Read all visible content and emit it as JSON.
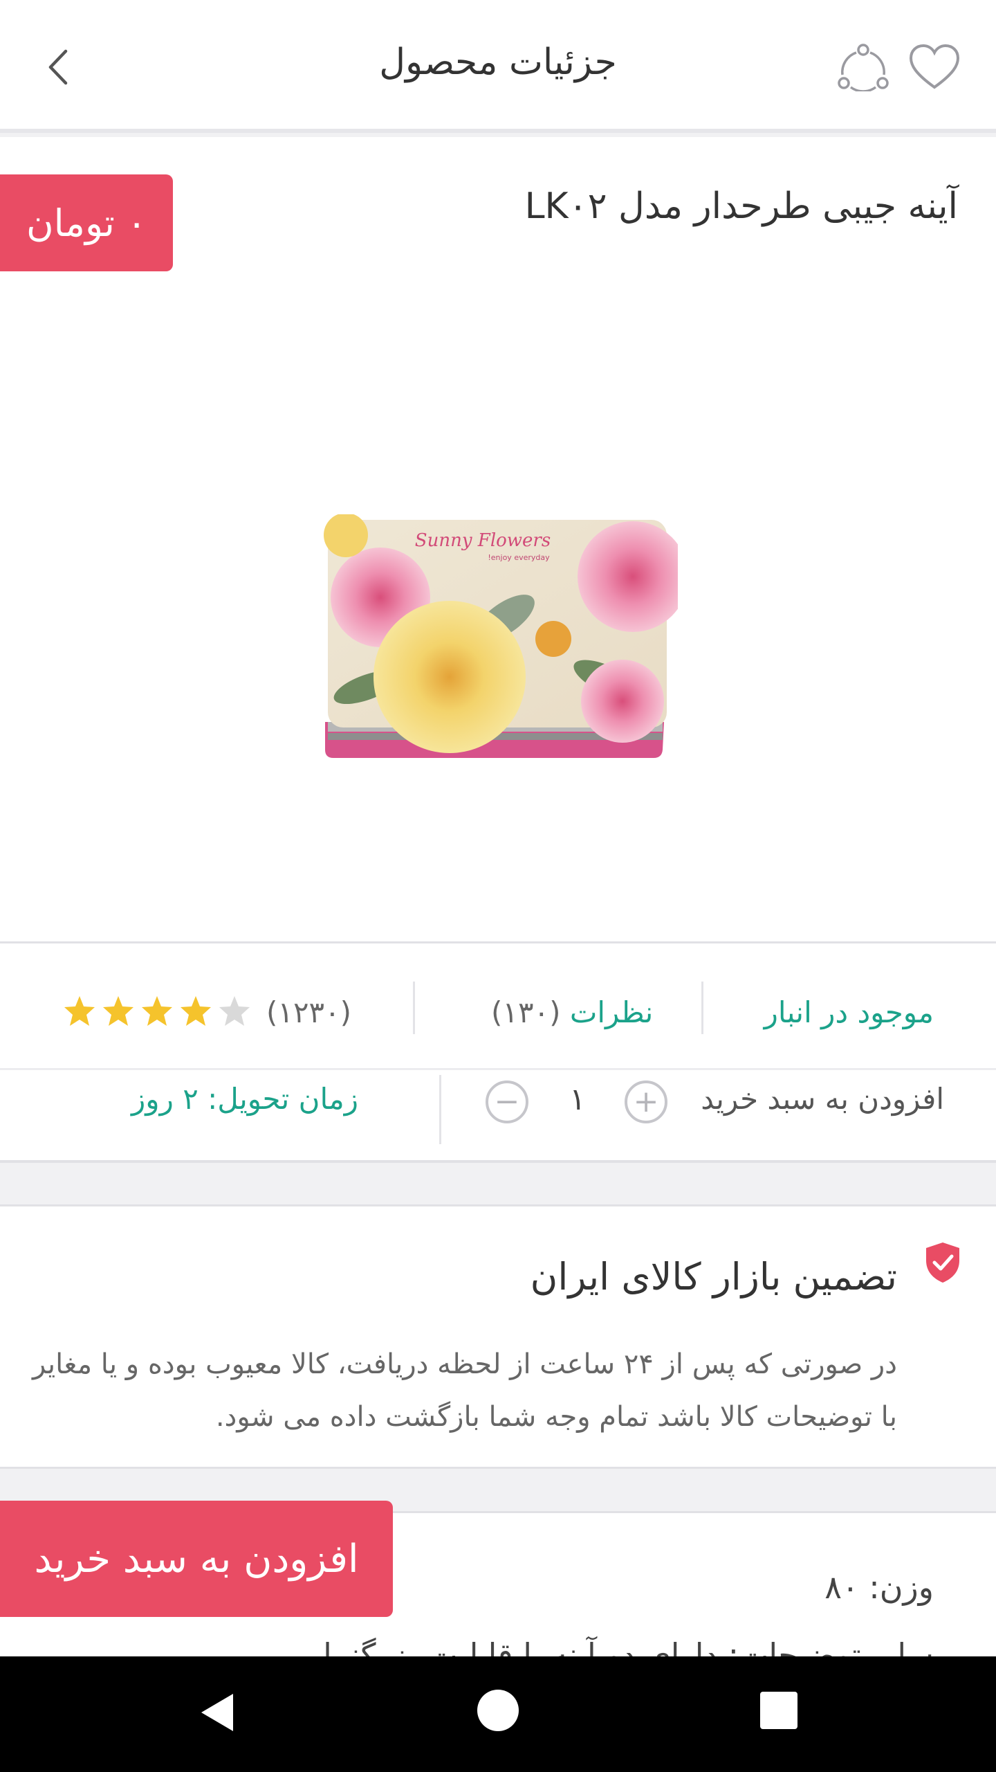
{
  "header": {
    "title": "جزئیات محصول"
  },
  "product": {
    "title": "آینه جیبی طرحدار مدل LK۰۲",
    "price": "۰ تومان",
    "image_text": {
      "brand": "Sunny Flowers",
      "tagline": "enjoy everyday!"
    }
  },
  "info": {
    "stock": "موجود در انبار",
    "reviews_label": "نظرات",
    "reviews_count": "(۱۳۰)",
    "rating_count": "(۱۲۳۰)",
    "rating": 4,
    "rating_max": 5,
    "add_to_cart_label": "افزودن به سبد خرید",
    "quantity": "۱",
    "delivery": "زمان تحویل: ۲ روز"
  },
  "guarantee": {
    "title": "تضمین بازار کالای ایران",
    "description": "در صورتی که پس از ۲۴ ساعت از لحظه دریافت، کالا معیوب بوده و یا مغایر با توضیحات کالا باشد تمام وجه شما بازگشت داده می شود."
  },
  "details": {
    "weight": "وزن: ۸۰",
    "other": "سایر توضیحات: دارای دو آینه با قابلیت بزرگنمایی"
  },
  "actions": {
    "add_to_cart": "افزودن به سبد خرید"
  },
  "colors": {
    "accent": "#e94c64",
    "green": "#1ba28a",
    "star": "#f5c32c",
    "star_empty": "#d9d9d9"
  }
}
